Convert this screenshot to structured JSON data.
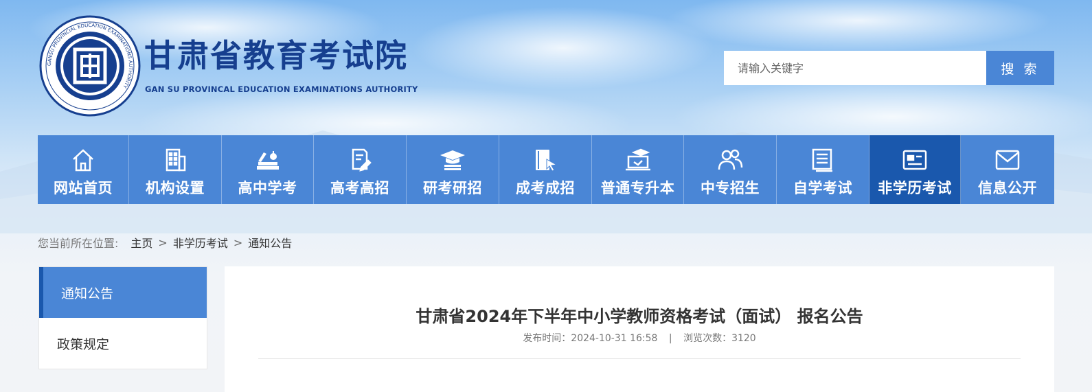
{
  "header": {
    "site_title": "甘肃省教育考试院",
    "site_subtitle": "GAN SU PROVINCAL EDUCATION EXAMINATIONS AUTHORITY",
    "logo_center_char": "固",
    "logo_ring_text": "GANSU PROVINCIAL EDUCATION EXAMINATIONS AUTHORITY"
  },
  "search": {
    "placeholder": "请输入关键字",
    "button_label": "搜 索"
  },
  "nav": {
    "items": [
      {
        "label": "网站首页",
        "icon": "home-icon"
      },
      {
        "label": "机构设置",
        "icon": "building-icon"
      },
      {
        "label": "高中学考",
        "icon": "books-icon"
      },
      {
        "label": "高考高招",
        "icon": "document-pen-icon"
      },
      {
        "label": "研考研招",
        "icon": "graduation-cap-icon"
      },
      {
        "label": "成考成招",
        "icon": "book-pointer-icon"
      },
      {
        "label": "普通专升本",
        "icon": "laptop-cap-icon"
      },
      {
        "label": "中专招生",
        "icon": "users-icon"
      },
      {
        "label": "自学考试",
        "icon": "notebook-icon"
      },
      {
        "label": "非学历考试",
        "icon": "id-card-icon"
      },
      {
        "label": "信息公开",
        "icon": "mail-icon"
      }
    ],
    "active_index": 9
  },
  "breadcrumb": {
    "prefix": "您当前所在位置:",
    "crumbs": [
      "主页",
      "非学历考试",
      "通知公告"
    ],
    "separator": ">"
  },
  "sidebar": {
    "items": [
      {
        "label": "通知公告",
        "active": true
      },
      {
        "label": "政策规定",
        "active": false
      }
    ]
  },
  "article": {
    "title": "甘肃省2024年下半年中小学教师资格考试（面试） 报名公告",
    "publish_label": "发布时间：2024-10-31 16:58",
    "divider": "|",
    "views_label": "浏览次数：3120"
  },
  "colors": {
    "nav_bg": "#4a86d6",
    "nav_active_bg": "#1a58ad",
    "brand_text": "#163f8f",
    "search_button": "#4a86d6"
  }
}
